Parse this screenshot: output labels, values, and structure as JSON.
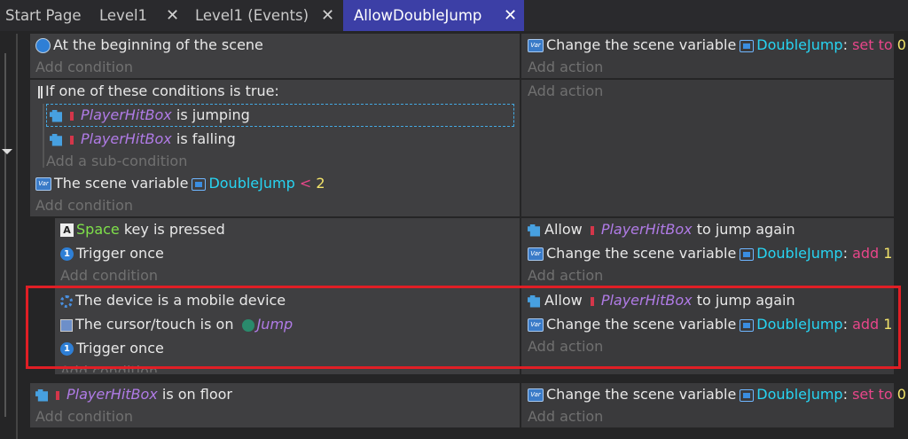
{
  "tabs": [
    {
      "label": "Start Page",
      "closable": false
    },
    {
      "label": "Level1",
      "closable": true
    },
    {
      "label": "Level1 (Events)",
      "closable": true
    },
    {
      "label": "AllowDoubleJump",
      "closable": true,
      "active": true
    }
  ],
  "common": {
    "add_condition": "Add condition",
    "add_action": "Add action",
    "add_sub_condition": "Add a sub-condition",
    "change_var": "Change the scene variable",
    "allow": "Allow",
    "to_jump_again": "to jump again",
    "var_name": "DoubleJump",
    "colon": ":",
    "set_to": "set to",
    "add": "add",
    "zero": "0",
    "one": "1",
    "player": "PlayerHitBox",
    "trigger_once": "Trigger once"
  },
  "events": {
    "e1": {
      "condition": "At the beginning of the scene"
    },
    "e2": {
      "or_label": "If one of these conditions is true:",
      "sub1": "is jumping",
      "sub2": "is falling",
      "cond2_text": "The scene variable",
      "op": "<",
      "value": "2"
    },
    "e3": {
      "key": "Space",
      "key_rest": "key is pressed"
    },
    "e4": {
      "mobile": "The device is a mobile device",
      "cursor": "The cursor/touch is on",
      "button": "Jump"
    },
    "e5": {
      "floor": "is on floor"
    }
  },
  "colors": {
    "active_tab": "#3c3fa6",
    "highlight": "#e01e25",
    "variable": "#27d4f2",
    "object": "#b07be6",
    "operation": "#e8468a",
    "number": "#f3e46a"
  }
}
